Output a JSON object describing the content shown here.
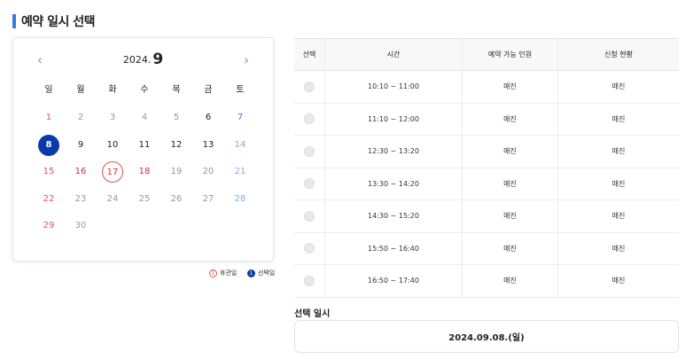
{
  "title": "예약 일시 선택",
  "calendar": {
    "year_label": "2024.",
    "month_label": "9",
    "prev_icon": "chevron-left-icon",
    "next_icon": "chevron-right-icon",
    "weekdays": [
      "일",
      "월",
      "화",
      "수",
      "목",
      "금",
      "토"
    ],
    "days": [
      {
        "d": "1",
        "col": 0,
        "row": 0,
        "state": "sun"
      },
      {
        "d": "2",
        "col": 1,
        "row": 0,
        "state": "past"
      },
      {
        "d": "3",
        "col": 2,
        "row": 0,
        "state": "past"
      },
      {
        "d": "4",
        "col": 3,
        "row": 0,
        "state": "past"
      },
      {
        "d": "5",
        "col": 4,
        "row": 0,
        "state": "past"
      },
      {
        "d": "6",
        "col": 5,
        "row": 0,
        "state": "avail"
      },
      {
        "d": "7",
        "col": 6,
        "row": 0,
        "state": "sat"
      },
      {
        "d": "8",
        "col": 0,
        "row": 1,
        "state": "selected"
      },
      {
        "d": "9",
        "col": 1,
        "row": 1,
        "state": "avail"
      },
      {
        "d": "10",
        "col": 2,
        "row": 1,
        "state": "avail"
      },
      {
        "d": "11",
        "col": 3,
        "row": 1,
        "state": "avail"
      },
      {
        "d": "12",
        "col": 4,
        "row": 1,
        "state": "avail"
      },
      {
        "d": "13",
        "col": 5,
        "row": 1,
        "state": "avail"
      },
      {
        "d": "14",
        "col": 6,
        "row": 1,
        "state": "sat-past"
      },
      {
        "d": "15",
        "col": 0,
        "row": 2,
        "state": "sun"
      },
      {
        "d": "16",
        "col": 1,
        "row": 2,
        "state": "holiday"
      },
      {
        "d": "17",
        "col": 2,
        "row": 2,
        "state": "holiday-ring"
      },
      {
        "d": "18",
        "col": 3,
        "row": 2,
        "state": "holiday"
      },
      {
        "d": "19",
        "col": 4,
        "row": 2,
        "state": "past"
      },
      {
        "d": "20",
        "col": 5,
        "row": 2,
        "state": "past"
      },
      {
        "d": "21",
        "col": 6,
        "row": 2,
        "state": "sat-past"
      },
      {
        "d": "22",
        "col": 0,
        "row": 3,
        "state": "sun"
      },
      {
        "d": "23",
        "col": 1,
        "row": 3,
        "state": "past"
      },
      {
        "d": "24",
        "col": 2,
        "row": 3,
        "state": "past"
      },
      {
        "d": "25",
        "col": 3,
        "row": 3,
        "state": "past"
      },
      {
        "d": "26",
        "col": 4,
        "row": 3,
        "state": "past"
      },
      {
        "d": "27",
        "col": 5,
        "row": 3,
        "state": "past"
      },
      {
        "d": "28",
        "col": 6,
        "row": 3,
        "state": "sat-past"
      },
      {
        "d": "29",
        "col": 0,
        "row": 4,
        "state": "sun"
      },
      {
        "d": "30",
        "col": 1,
        "row": 4,
        "state": "past"
      }
    ]
  },
  "legend": {
    "holiday_marker": "1",
    "holiday_label": "휴관일",
    "selected_marker": "1",
    "selected_label": "선택일"
  },
  "table": {
    "headers": [
      "선택",
      "시간",
      "예약 가능 인원",
      "신청 현황"
    ],
    "rows": [
      {
        "time": "10:10 ~ 11:00",
        "available": "매진",
        "status": "매진"
      },
      {
        "time": "11:10 ~ 12:00",
        "available": "매진",
        "status": "매진"
      },
      {
        "time": "12:30 ~ 13:20",
        "available": "매진",
        "status": "매진"
      },
      {
        "time": "13:30 ~ 14:20",
        "available": "매진",
        "status": "매진"
      },
      {
        "time": "14:30 ~ 15:20",
        "available": "매진",
        "status": "매진"
      },
      {
        "time": "15:50 ~ 16:40",
        "available": "매진",
        "status": "매진"
      },
      {
        "time": "16:50 ~ 17:40",
        "available": "매진",
        "status": "매진"
      }
    ]
  },
  "selection": {
    "label": "선택 일시",
    "value": "2024.09.08.(일)"
  },
  "colors": {
    "accent": "#3a7be0",
    "selected": "#0a3aa8",
    "holiday": "#d32f2f"
  }
}
